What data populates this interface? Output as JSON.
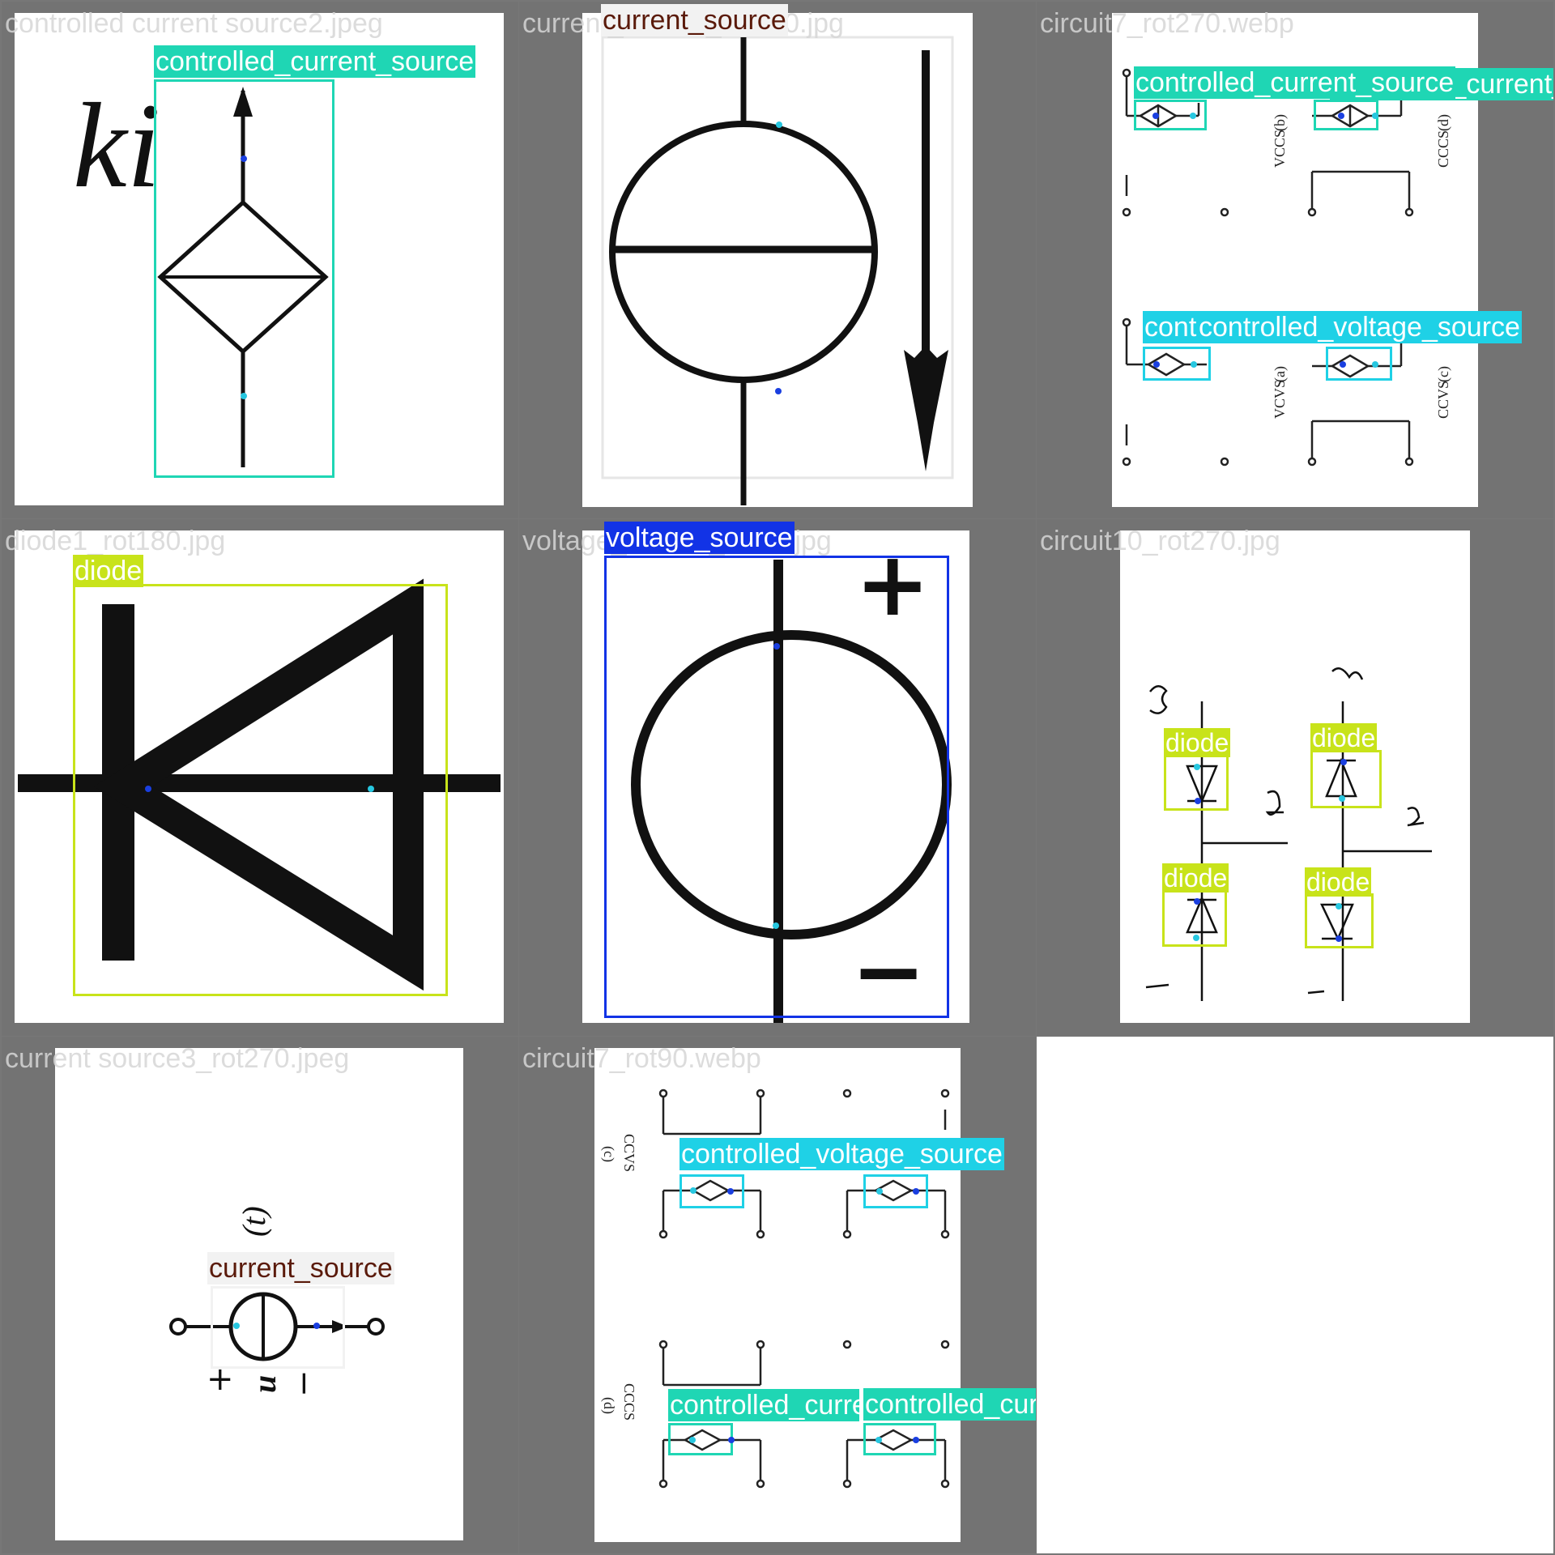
{
  "colors": {
    "controlled_current_source": "#1fd6b4",
    "controlled_voltage_source": "#1fd1e6",
    "current_source": "#f2f2f2",
    "current_source_text": "#5a1a0a",
    "diode": "#c8e31a",
    "voltage_source": "#1233e6",
    "keypoint_a": "#1a3fe0",
    "keypoint_b": "#27c7e0"
  },
  "tiles": [
    {
      "file": "controlled current source2.jpeg",
      "labels": [
        "controlled_current_source"
      ],
      "texts": [
        "ki"
      ]
    },
    {
      "file": "current_source_rot180.jpg",
      "labels": [
        "current_source"
      ],
      "texts": []
    },
    {
      "file": "circuit7_rot270.webp",
      "labels": [
        "controlled_current_source",
        "controlled_current_source",
        "controlled_voltage_source",
        "controlled_voltage_source"
      ],
      "texts": [
        "VCCS",
        "(b)",
        "CCCS",
        "(d)",
        "VCVS",
        "(a)",
        "CCVS",
        "(c)"
      ]
    },
    {
      "file": "diode1_rot180.jpg",
      "labels": [
        "diode"
      ],
      "texts": []
    },
    {
      "file": "voltage_source_rot90.jpg",
      "labels": [
        "voltage_source"
      ],
      "texts": [
        "+",
        "−"
      ]
    },
    {
      "file": "circuit10_rot270.jpg",
      "labels": [
        "diode",
        "diode",
        "diode",
        "diode"
      ],
      "texts": []
    },
    {
      "file": "current source3_rot270.jpeg",
      "labels": [
        "current_source"
      ],
      "texts": [
        "(t)",
        "+",
        "u",
        "−"
      ]
    },
    {
      "file": "circuit7_rot90.webp",
      "labels": [
        "controlled_voltage_source",
        "controlled_voltage_source",
        "controlled_current_source",
        "controlled_current_source"
      ],
      "texts": [
        "CCVS",
        "(c)",
        "CCCS",
        "(d)"
      ]
    }
  ]
}
